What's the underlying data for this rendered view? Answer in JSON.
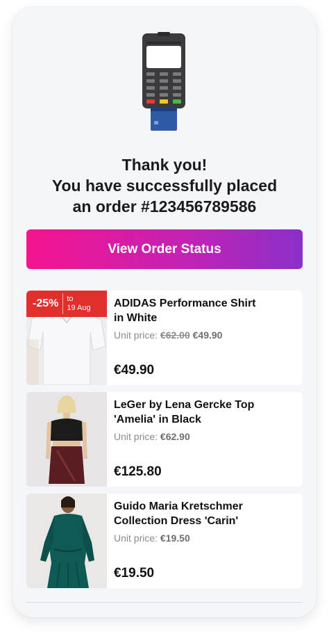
{
  "confirmation": {
    "title": "Thank you!",
    "line2": "You have successfully placed",
    "line3": "an order #123456789586"
  },
  "cta": {
    "label": "View Order Status"
  },
  "items": [
    {
      "name_line1": "ADIDAS Performance Shirt",
      "name_line2": "in White",
      "unit_label": "Unit price:",
      "old_price": "€62.00",
      "unit_price": "€49.90",
      "total": "€49.90",
      "badge": {
        "discount": "-25%",
        "to_label": "to",
        "date": "19 Aug"
      }
    },
    {
      "name_line1": "LeGer by Lena Gercke Top",
      "name_line2": "'Amelia' in Black",
      "unit_label": "Unit price:",
      "unit_price": "€62.90",
      "total": "€125.80"
    },
    {
      "name_line1": "Guido Maria Kretschmer",
      "name_line2": "Collection Dress 'Carin'",
      "unit_label": "Unit price:",
      "unit_price": "€19.50",
      "total": "€19.50"
    }
  ],
  "colors": {
    "accent_start": "#f5138e",
    "accent_end": "#8b2fc9",
    "badge": "#e32e2e",
    "background": "#f5f6fa"
  }
}
